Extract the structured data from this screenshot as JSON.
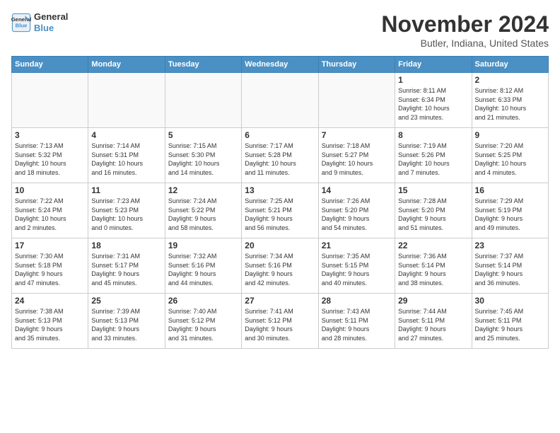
{
  "app": {
    "logo_line1": "General",
    "logo_line2": "Blue"
  },
  "header": {
    "title": "November 2024",
    "location": "Butler, Indiana, United States"
  },
  "weekdays": [
    "Sunday",
    "Monday",
    "Tuesday",
    "Wednesday",
    "Thursday",
    "Friday",
    "Saturday"
  ],
  "weeks": [
    [
      {
        "day": "",
        "info": ""
      },
      {
        "day": "",
        "info": ""
      },
      {
        "day": "",
        "info": ""
      },
      {
        "day": "",
        "info": ""
      },
      {
        "day": "",
        "info": ""
      },
      {
        "day": "1",
        "info": "Sunrise: 8:11 AM\nSunset: 6:34 PM\nDaylight: 10 hours\nand 23 minutes."
      },
      {
        "day": "2",
        "info": "Sunrise: 8:12 AM\nSunset: 6:33 PM\nDaylight: 10 hours\nand 21 minutes."
      }
    ],
    [
      {
        "day": "3",
        "info": "Sunrise: 7:13 AM\nSunset: 5:32 PM\nDaylight: 10 hours\nand 18 minutes."
      },
      {
        "day": "4",
        "info": "Sunrise: 7:14 AM\nSunset: 5:31 PM\nDaylight: 10 hours\nand 16 minutes."
      },
      {
        "day": "5",
        "info": "Sunrise: 7:15 AM\nSunset: 5:30 PM\nDaylight: 10 hours\nand 14 minutes."
      },
      {
        "day": "6",
        "info": "Sunrise: 7:17 AM\nSunset: 5:28 PM\nDaylight: 10 hours\nand 11 minutes."
      },
      {
        "day": "7",
        "info": "Sunrise: 7:18 AM\nSunset: 5:27 PM\nDaylight: 10 hours\nand 9 minutes."
      },
      {
        "day": "8",
        "info": "Sunrise: 7:19 AM\nSunset: 5:26 PM\nDaylight: 10 hours\nand 7 minutes."
      },
      {
        "day": "9",
        "info": "Sunrise: 7:20 AM\nSunset: 5:25 PM\nDaylight: 10 hours\nand 4 minutes."
      }
    ],
    [
      {
        "day": "10",
        "info": "Sunrise: 7:22 AM\nSunset: 5:24 PM\nDaylight: 10 hours\nand 2 minutes."
      },
      {
        "day": "11",
        "info": "Sunrise: 7:23 AM\nSunset: 5:23 PM\nDaylight: 10 hours\nand 0 minutes."
      },
      {
        "day": "12",
        "info": "Sunrise: 7:24 AM\nSunset: 5:22 PM\nDaylight: 9 hours\nand 58 minutes."
      },
      {
        "day": "13",
        "info": "Sunrise: 7:25 AM\nSunset: 5:21 PM\nDaylight: 9 hours\nand 56 minutes."
      },
      {
        "day": "14",
        "info": "Sunrise: 7:26 AM\nSunset: 5:20 PM\nDaylight: 9 hours\nand 54 minutes."
      },
      {
        "day": "15",
        "info": "Sunrise: 7:28 AM\nSunset: 5:20 PM\nDaylight: 9 hours\nand 51 minutes."
      },
      {
        "day": "16",
        "info": "Sunrise: 7:29 AM\nSunset: 5:19 PM\nDaylight: 9 hours\nand 49 minutes."
      }
    ],
    [
      {
        "day": "17",
        "info": "Sunrise: 7:30 AM\nSunset: 5:18 PM\nDaylight: 9 hours\nand 47 minutes."
      },
      {
        "day": "18",
        "info": "Sunrise: 7:31 AM\nSunset: 5:17 PM\nDaylight: 9 hours\nand 45 minutes."
      },
      {
        "day": "19",
        "info": "Sunrise: 7:32 AM\nSunset: 5:16 PM\nDaylight: 9 hours\nand 44 minutes."
      },
      {
        "day": "20",
        "info": "Sunrise: 7:34 AM\nSunset: 5:16 PM\nDaylight: 9 hours\nand 42 minutes."
      },
      {
        "day": "21",
        "info": "Sunrise: 7:35 AM\nSunset: 5:15 PM\nDaylight: 9 hours\nand 40 minutes."
      },
      {
        "day": "22",
        "info": "Sunrise: 7:36 AM\nSunset: 5:14 PM\nDaylight: 9 hours\nand 38 minutes."
      },
      {
        "day": "23",
        "info": "Sunrise: 7:37 AM\nSunset: 5:14 PM\nDaylight: 9 hours\nand 36 minutes."
      }
    ],
    [
      {
        "day": "24",
        "info": "Sunrise: 7:38 AM\nSunset: 5:13 PM\nDaylight: 9 hours\nand 35 minutes."
      },
      {
        "day": "25",
        "info": "Sunrise: 7:39 AM\nSunset: 5:13 PM\nDaylight: 9 hours\nand 33 minutes."
      },
      {
        "day": "26",
        "info": "Sunrise: 7:40 AM\nSunset: 5:12 PM\nDaylight: 9 hours\nand 31 minutes."
      },
      {
        "day": "27",
        "info": "Sunrise: 7:41 AM\nSunset: 5:12 PM\nDaylight: 9 hours\nand 30 minutes."
      },
      {
        "day": "28",
        "info": "Sunrise: 7:43 AM\nSunset: 5:11 PM\nDaylight: 9 hours\nand 28 minutes."
      },
      {
        "day": "29",
        "info": "Sunrise: 7:44 AM\nSunset: 5:11 PM\nDaylight: 9 hours\nand 27 minutes."
      },
      {
        "day": "30",
        "info": "Sunrise: 7:45 AM\nSunset: 5:11 PM\nDaylight: 9 hours\nand 25 minutes."
      }
    ]
  ]
}
